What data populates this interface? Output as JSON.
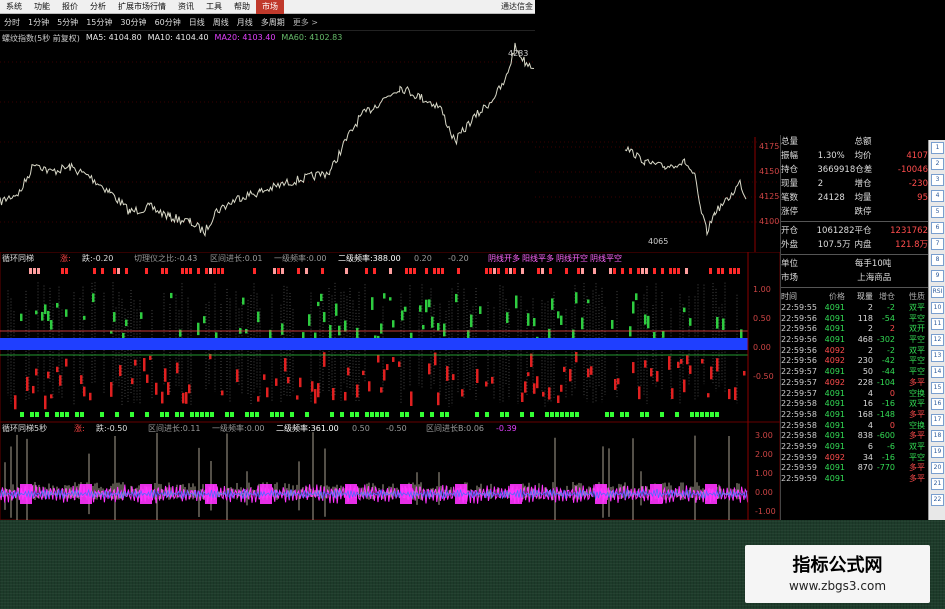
{
  "menu": {
    "items": [
      "系统",
      "功能",
      "报价",
      "分析",
      "扩展市场行情",
      "资讯",
      "工具",
      "帮助",
      "市场"
    ],
    "active": "市场",
    "app_title": "通达信金"
  },
  "periods": [
    "分时",
    "1分钟",
    "5分钟",
    "15分钟",
    "30分钟",
    "60分钟",
    "日线",
    "周线",
    "月线",
    "多周期",
    "更多 >"
  ],
  "main_chart": {
    "title": "螺纹指数(5秒 前复权)",
    "ma": [
      {
        "label": "MA5: 4104.80",
        "color": "#e6e6e6"
      },
      {
        "label": "MA10: 4104.40",
        "color": "#e6e6e6"
      },
      {
        "label": "MA20: 4103.40",
        "color": "#e040fb"
      },
      {
        "label": "MA60: 4102.83",
        "color": "#66bb6a"
      }
    ],
    "high_label": "4283",
    "low_label": "4065",
    "axis_labels": [
      "4175",
      "4150",
      "4125",
      "4100"
    ]
  },
  "indicator1": {
    "title": "循环同梯",
    "items": [
      {
        "text": "涨:",
        "color": "#ff4444"
      },
      {
        "text": "跌:-0.20",
        "color": "#dddddd"
      },
      {
        "text": "切理仪之比:-0.43",
        "color": "#999999"
      },
      {
        "text": "区间进长:0.01",
        "color": "#999999"
      },
      {
        "text": "一级频率:0.00",
        "color": "#999999"
      },
      {
        "text": "二级频率:388.00",
        "color": "#ffffff"
      },
      {
        "text": "0.20",
        "color": "#999999"
      },
      {
        "text": "-0.20",
        "color": "#999999"
      },
      {
        "text": "阴线开多",
        "color": "#ff66ff"
      },
      {
        "text": "阳线平多",
        "color": "#ff66ff"
      },
      {
        "text": "阴线开空",
        "color": "#ff66ff"
      },
      {
        "text": "阴线平空",
        "color": "#ff66ff"
      }
    ],
    "axis_labels": [
      "1.00",
      "0.50",
      "0.00",
      "-0.50"
    ]
  },
  "indicator2": {
    "title": "循环同梯5秒",
    "items": [
      {
        "text": "涨:",
        "color": "#ff4444"
      },
      {
        "text": "跌:-0.50",
        "color": "#dddddd"
      },
      {
        "text": "区间进长:0.11",
        "color": "#999999"
      },
      {
        "text": "一级频率:0.00",
        "color": "#999999"
      },
      {
        "text": "二级频率:361.00",
        "color": "#ffffff"
      },
      {
        "text": "0.50",
        "color": "#999999"
      },
      {
        "text": "-0.50",
        "color": "#999999"
      },
      {
        "text": "区间进长B:0.06",
        "color": "#999999"
      },
      {
        "text": "-0.39",
        "color": "#e040fb"
      }
    ],
    "axis_labels": [
      "3.00",
      "2.00",
      "1.00",
      "0.00",
      "-1.00"
    ]
  },
  "quote_panel": {
    "rows": [
      {
        "k1": "总量",
        "v1": "",
        "k2": "总额",
        "v2": ""
      },
      {
        "k1": "振幅",
        "v1": "1.30%",
        "k2": "均价",
        "v2": "4107"
      },
      {
        "k1": "持仓",
        "v1": "3669918",
        "k2": "仓差",
        "v2": "-10046"
      },
      {
        "k1": "现量",
        "v1": "2",
        "k2": "增仓",
        "v2": "-230"
      },
      {
        "k1": "笔数",
        "v1": "24128",
        "k2": "均量",
        "v2": "95"
      },
      {
        "k1": "涨停",
        "v1": "",
        "k2": "跌停",
        "v2": ""
      },
      {
        "k1": "开仓",
        "v1": "1061282",
        "k2": "平仓",
        "v2": "1231762"
      },
      {
        "k1": "外盘",
        "v1": "107.5万",
        "k2": "内盘",
        "v2": "121.8万"
      },
      {
        "k1": "单位",
        "v1": "",
        "k2": "每手10吨",
        "v2": ""
      },
      {
        "k1": "市场",
        "v1": "",
        "k2": "上海商品",
        "v2": ""
      }
    ],
    "tick_headers": [
      "时间",
      "价格",
      "现量",
      "增仓",
      "性质"
    ],
    "ticks": [
      {
        "time": "22:59:55",
        "price": "4091",
        "vol": "2",
        "oi": "-2",
        "nature": "双平",
        "up": false
      },
      {
        "time": "22:59:56",
        "price": "4091",
        "vol": "118",
        "oi": "-54",
        "nature": "平空",
        "up": false
      },
      {
        "time": "22:59:56",
        "price": "4091",
        "vol": "2",
        "oi": "2",
        "nature": "双开",
        "up": false
      },
      {
        "time": "22:59:56",
        "price": "4091",
        "vol": "468",
        "oi": "-302",
        "nature": "平空",
        "up": false
      },
      {
        "time": "22:59:56",
        "price": "4092",
        "vol": "2",
        "oi": "-2",
        "nature": "双平",
        "up": true
      },
      {
        "time": "22:59:56",
        "price": "4092",
        "vol": "230",
        "oi": "-42",
        "nature": "平空",
        "up": true
      },
      {
        "time": "22:59:57",
        "price": "4091",
        "vol": "50",
        "oi": "-44",
        "nature": "平空",
        "up": false
      },
      {
        "time": "22:59:57",
        "price": "4092",
        "vol": "228",
        "oi": "-104",
        "nature": "多平",
        "up": true
      },
      {
        "time": "22:59:57",
        "price": "4091",
        "vol": "4",
        "oi": "0",
        "nature": "空换",
        "up": false
      },
      {
        "time": "22:59:58",
        "price": "4091",
        "vol": "16",
        "oi": "-16",
        "nature": "双平",
        "up": false
      },
      {
        "time": "22:59:58",
        "price": "4091",
        "vol": "168",
        "oi": "-148",
        "nature": "多平",
        "up": false
      },
      {
        "time": "22:59:58",
        "price": "4091",
        "vol": "4",
        "oi": "0",
        "nature": "空换",
        "up": false
      },
      {
        "time": "22:59:58",
        "price": "4091",
        "vol": "838",
        "oi": "-600",
        "nature": "多平",
        "up": false
      },
      {
        "time": "22:59:59",
        "price": "4091",
        "vol": "6",
        "oi": "-6",
        "nature": "双平",
        "up": false
      },
      {
        "time": "22:59:59",
        "price": "4092",
        "vol": "34",
        "oi": "-16",
        "nature": "平空",
        "up": true
      },
      {
        "time": "22:59:59",
        "price": "4091",
        "vol": "870",
        "oi": "-770",
        "nature": "多平",
        "up": false
      },
      {
        "time": "22:59:59",
        "price": "4091",
        "vol": "",
        "oi": "",
        "nature": "多平",
        "up": false
      }
    ]
  },
  "side_toolbar": [
    "1",
    "2",
    "3",
    "4",
    "5",
    "6",
    "7",
    "8",
    "9",
    "RSI",
    "10",
    "11",
    "12",
    "13",
    "14",
    "15",
    "16",
    "17",
    "18",
    "19",
    "20",
    "21",
    "22"
  ],
  "watermark": {
    "title": "指标公式网",
    "url": "www.zbgs3.com"
  },
  "colors": {
    "up": "#ff3b3b",
    "down": "#00e676",
    "blue_band": "#1f3fff",
    "magenta": "#ff33ff",
    "price_line": "#d9d9c8"
  }
}
